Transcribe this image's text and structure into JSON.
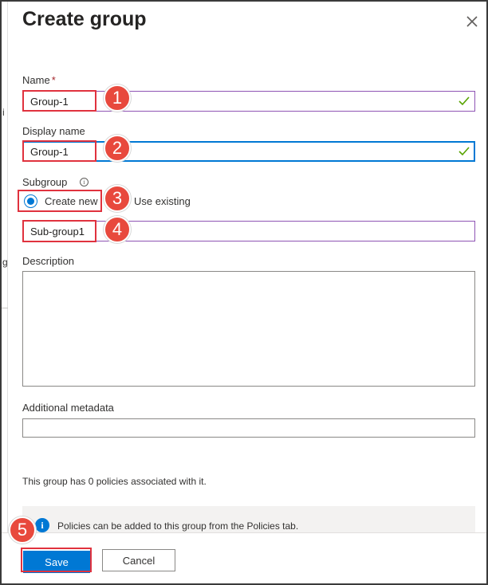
{
  "header": {
    "title": "Create group",
    "close_icon": "close-icon"
  },
  "form": {
    "name": {
      "label": "Name",
      "required_mark": "*",
      "value": "Group-1"
    },
    "display_name": {
      "label": "Display name",
      "value": "Group-1"
    },
    "subgroup": {
      "label": "Subgroup",
      "info_glyph": "i",
      "options": [
        "Create new",
        "Use existing"
      ],
      "selected": "Create new",
      "value": "Sub-group1"
    },
    "description": {
      "label": "Description",
      "value": ""
    },
    "additional_metadata": {
      "label": "Additional metadata",
      "value": ""
    }
  },
  "policies_text": "This group has 0 policies associated with it.",
  "info_bar": {
    "icon": "info-icon",
    "glyph": "i",
    "message": "Policies can be added to this group from the Policies tab."
  },
  "footer": {
    "save_label": "Save",
    "cancel_label": "Cancel"
  },
  "callouts": [
    "1",
    "2",
    "3",
    "4",
    "5"
  ],
  "background_fragments": [
    "i",
    "g"
  ],
  "colors": {
    "accent": "#0078d4",
    "callout": "#e8493d",
    "valid_check": "#57a300",
    "focus_purple": "#8f54b4"
  }
}
